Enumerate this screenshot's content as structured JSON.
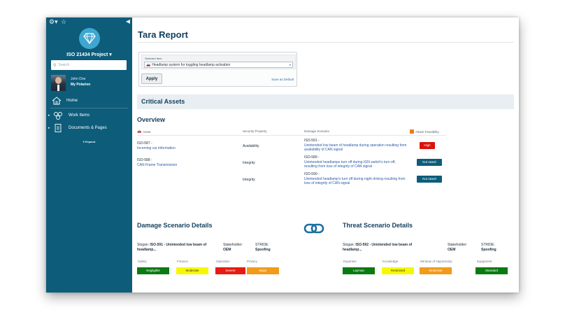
{
  "window": {
    "expand_tools": "Expand Tools"
  },
  "sidebar": {
    "project": "ISO 21434 Project",
    "project_caret": "▾",
    "search_placeholder": "Search",
    "user_name": "John Doe",
    "user_link": "My Polarion",
    "home": "Home",
    "work_items": "Work Items",
    "documents": "Documents & Pages",
    "expand": "▾ Expand",
    "icons": {
      "gear": "gear-icon",
      "star": "star-icon",
      "collapse": "chevron-left-icon"
    }
  },
  "page": {
    "title": "Tara Report",
    "selected_item_label": "Selected Item",
    "selected_item_value": "Headlamp system for toggling headlamp activation",
    "apply": "Apply",
    "save_default": "Save as Default",
    "section": "Critical Assets",
    "overview": "Overview"
  },
  "table": {
    "headers": {
      "asset": "Asset",
      "security_property": "Security Property",
      "damage_scenario": "Damage Scenario",
      "attack_feasibility": "Attack Feasibility"
    },
    "rows": [
      {
        "asset_id": "ISO-587 -",
        "asset_name": "Incoming car information",
        "property": "Availability",
        "ds_id": "ISO-591 -",
        "ds_text": "Unintended low beam of headlamp during operation resulting from availability of CAN signal",
        "feasibility": "High",
        "color": "#d9130b"
      },
      {
        "asset_id": "ISO-588 -",
        "asset_name": "CAN Frame Transmission",
        "property": "Integrity",
        "ds_id": "ISO-589 -",
        "ds_text": "Unintended headlamps turn off during IGN switch's turn off, resulting from loss of integrity of CAN signal",
        "feasibility": "Not rated!",
        "color": "#0d5c7a"
      },
      {
        "asset_id": "",
        "asset_name": "",
        "property": "Integrity",
        "ds_id": "ISO-590 -",
        "ds_text": "Unintended headlamp's turn off during night driving resulting from loss of integrity of CAN signal",
        "feasibility": "Not rated!",
        "color": "#0d5c7a"
      }
    ]
  },
  "damage_details": {
    "title": "Damage Scenario Details",
    "slogan_label": "Slogan:",
    "slogan_id": "ISO-591",
    "slogan_text": "- Unintended low beam of headlamp...",
    "stakeholder_label": "Stakeholder:",
    "stakeholder": "OEM",
    "stride_label": "STRIDE:",
    "stride": "Spoofing",
    "levels": [
      {
        "label": "Safety",
        "value": "Negligible",
        "color": "#0a7a12",
        "text_color": "#ffffff"
      },
      {
        "label": "Finance",
        "value": "Moderate",
        "color": "#f7f700",
        "text_color": "#333333"
      },
      {
        "label": "Operation",
        "value": "Severe",
        "color": "#e81b12",
        "text_color": "#ffffff"
      },
      {
        "label": "Privacy",
        "value": "Major",
        "color": "#f29a1a",
        "text_color": "#ffffff"
      }
    ]
  },
  "threat_details": {
    "title": "Threat Scenario Details",
    "slogan_label": "Slogan:",
    "slogan_id": "ISO-592",
    "slogan_text": "- Unintended low beam of headlamp...",
    "stakeholder_label": "Stakeholder:",
    "stakeholder": "OEM",
    "stride_label": "STRIDE:",
    "stride": "Spoofing",
    "levels": [
      {
        "label": "Expertise",
        "value": "Layman",
        "color": "#0a7a12",
        "text_color": "#ffffff"
      },
      {
        "label": "Knowledge",
        "value": "Restricted",
        "color": "#f7f700",
        "text_color": "#333333"
      },
      {
        "label": "Window of Opportunity",
        "value": "Moderate",
        "color": "#f29a1a",
        "text_color": "#ffffff"
      },
      {
        "label": "Equipment",
        "value": "Standard",
        "color": "#0a7a12",
        "text_color": "#ffffff"
      }
    ]
  },
  "link_icon": "link-chain-icon"
}
